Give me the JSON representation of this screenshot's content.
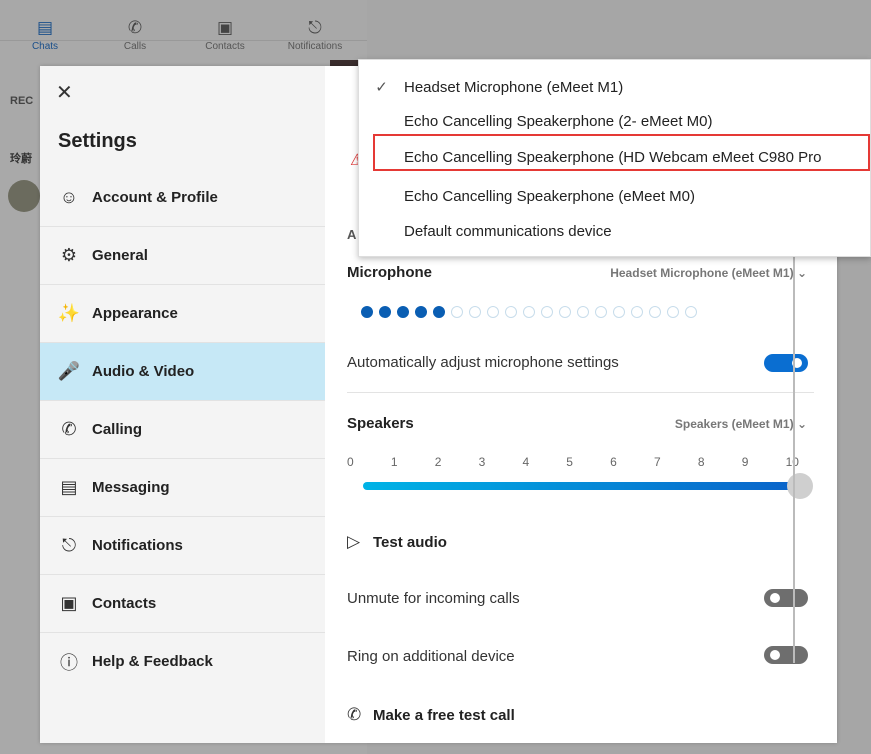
{
  "background": {
    "nav": [
      {
        "label": "Chats",
        "icon": "chat-icon"
      },
      {
        "label": "Calls",
        "icon": "phone-icon"
      },
      {
        "label": "Contacts",
        "icon": "contacts-icon"
      },
      {
        "label": "Notifications",
        "icon": "bell-icon"
      }
    ],
    "recent_label": "REC",
    "chat_snippet": "玲蔚"
  },
  "settings": {
    "title": "Settings",
    "close_icon": "close-icon",
    "sidebar": [
      {
        "label": "Account & Profile",
        "icon": "person-icon"
      },
      {
        "label": "General",
        "icon": "gear-icon"
      },
      {
        "label": "Appearance",
        "icon": "wand-icon"
      },
      {
        "label": "Audio & Video",
        "icon": "microphone-icon",
        "active": true
      },
      {
        "label": "Calling",
        "icon": "phone-icon"
      },
      {
        "label": "Messaging",
        "icon": "message-icon"
      },
      {
        "label": "Notifications",
        "icon": "bell-icon"
      },
      {
        "label": "Contacts",
        "icon": "contacts-icon"
      },
      {
        "label": "Help & Feedback",
        "icon": "info-icon"
      }
    ]
  },
  "audio": {
    "hidden_section_letter": "A",
    "microphone_title": "Microphone",
    "microphone_value": "Headset Microphone (eMeet M1)",
    "mic_level_dots_total": 19,
    "mic_level_dots_on": 5,
    "auto_adjust_label": "Automatically adjust microphone settings",
    "auto_adjust_on": true,
    "speakers_title": "Speakers",
    "speakers_value": "Speakers (eMeet M1)",
    "volume_ticks": [
      "0",
      "1",
      "2",
      "3",
      "4",
      "5",
      "6",
      "7",
      "8",
      "9",
      "10"
    ],
    "volume": 10,
    "test_audio_label": "Test audio",
    "unmute_label": "Unmute for incoming calls",
    "unmute_on": false,
    "ring_label": "Ring on additional device",
    "ring_on": false,
    "test_call_label": "Make a free test call"
  },
  "dropdown": {
    "items": [
      {
        "label": "Headset Microphone (eMeet M1)",
        "checked": true
      },
      {
        "label": "Echo Cancelling Speakerphone (2- eMeet M0)",
        "checked": false
      },
      {
        "label": "Echo Cancelling Speakerphone (HD Webcam eMeet C980 Pro",
        "checked": false,
        "highlighted": true
      },
      {
        "label": "Echo Cancelling Speakerphone (eMeet M0)",
        "checked": false
      },
      {
        "label": "Default communications device",
        "checked": false
      }
    ],
    "highlight_color": "#e53935"
  },
  "colors": {
    "accent": "#0a6ed1",
    "active_sidebar": "#c6e8f6"
  }
}
